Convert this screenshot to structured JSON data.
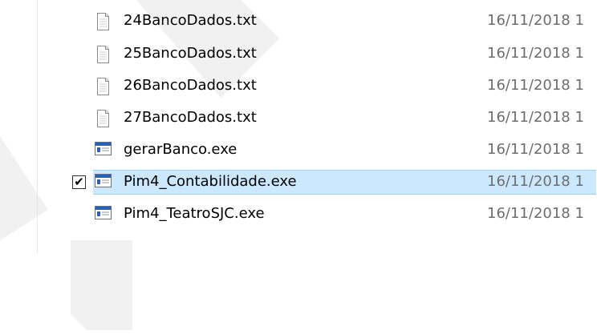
{
  "files": [
    {
      "name": "24BancoDados.txt",
      "modified": "16/11/2018 1",
      "icon": "text-file-icon",
      "selected": false
    },
    {
      "name": "25BancoDados.txt",
      "modified": "16/11/2018 1",
      "icon": "text-file-icon",
      "selected": false
    },
    {
      "name": "26BancoDados.txt",
      "modified": "16/11/2018 1",
      "icon": "text-file-icon",
      "selected": false
    },
    {
      "name": "27BancoDados.txt",
      "modified": "16/11/2018 1",
      "icon": "text-file-icon",
      "selected": false
    },
    {
      "name": "gerarBanco.exe",
      "modified": "16/11/2018 1",
      "icon": "executable-icon",
      "selected": false
    },
    {
      "name": "Pim4_Contabilidade.exe",
      "modified": "16/11/2018 1",
      "icon": "executable-icon",
      "selected": true,
      "checkmark": "✔"
    },
    {
      "name": "Pim4_TeatroSJC.exe",
      "modified": "16/11/2018 1",
      "icon": "executable-icon",
      "selected": false
    }
  ],
  "colors": {
    "selection_fill": "#cce8ff",
    "selection_border": "#99d1ff",
    "watermark": "#f1f1f1",
    "date_text": "#6d6d6d"
  }
}
